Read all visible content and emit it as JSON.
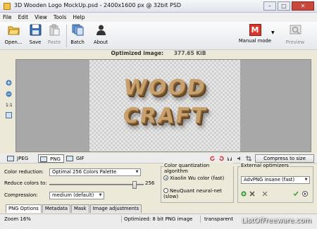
{
  "window": {
    "title": "3D Wooden Logo MockUp.psd - 2400x1600 px @ 32bit PSD"
  },
  "menu": [
    "File",
    "Edit",
    "View",
    "Tools",
    "Help"
  ],
  "toolbar": {
    "open": "Open...",
    "save": "Save",
    "paste": "Paste",
    "batch": "Batch",
    "about": "About",
    "manual": "Manual mode",
    "preview": "Preview"
  },
  "image_info": {
    "label": "Optimized image:",
    "size": "377.65 KiB"
  },
  "logo": {
    "line1": "WOOD",
    "line2": "CRAFT"
  },
  "format_tabs": [
    "JPEG",
    "PNG",
    "GIF"
  ],
  "compress_button": "Compress to size",
  "png_options": {
    "color_reduction_label": "Color reduction:",
    "color_reduction_value": "Optimal 256 Colors Palette",
    "reduce_label": "Reduce colors to:",
    "reduce_value": "256",
    "compression_label": "Compression:",
    "compression_value": "medium (default)"
  },
  "algorithm": {
    "legend": "Color quantization algorithm",
    "opt1": "Xiaolin Wu color (fast)",
    "opt2": "NeuQuant neural-net (slow)"
  },
  "external": {
    "legend": "External optimizers",
    "value": "AdvPNG insane (fast)"
  },
  "subtabs": [
    "PNG Options",
    "Metadata",
    "Mask",
    "Image adjustments"
  ],
  "status": {
    "zoom": "Zoom 16%",
    "optimized": "Optimized: 8 bit PNG image",
    "transparent": "transparent"
  },
  "watermark": "ListOfFreeware.com",
  "colors": {
    "accent": "#d8362b",
    "canvas_bg": "#a8a8a8",
    "wood": "#c7a06d"
  }
}
